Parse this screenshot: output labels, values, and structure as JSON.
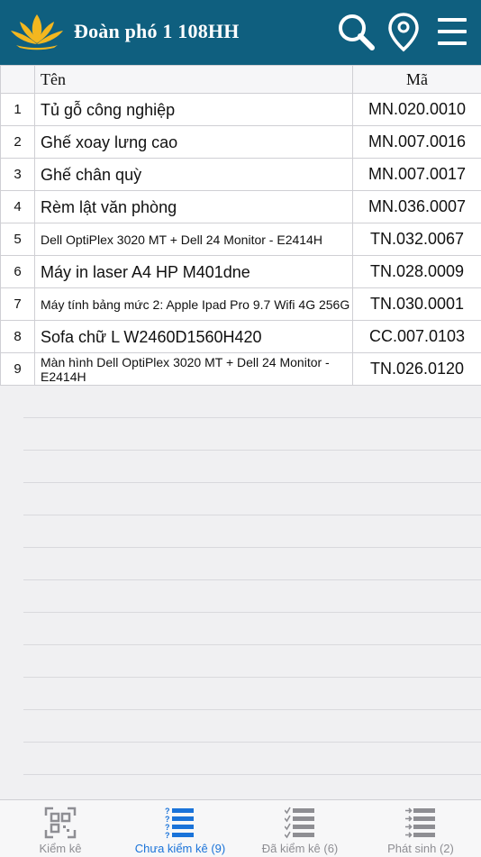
{
  "header": {
    "title": "Đoàn phó 1 108HH",
    "icons": [
      "lotus-logo-icon",
      "search-icon",
      "location-pin-icon",
      "hamburger-menu-icon"
    ],
    "color": "#0f5f7f"
  },
  "table": {
    "col_name": "Tên",
    "col_code": "Mã",
    "rows": [
      {
        "idx": "1",
        "name": "Tủ gỗ công nghiệp",
        "code": "MN.020.0010"
      },
      {
        "idx": "2",
        "name": "Ghế xoay lưng cao",
        "code": "MN.007.0016"
      },
      {
        "idx": "3",
        "name": "Ghế chân quỳ",
        "code": "MN.007.0017"
      },
      {
        "idx": "4",
        "name": "Rèm lật văn phòng",
        "code": "MN.036.0007"
      },
      {
        "idx": "5",
        "name": "Dell OptiPlex 3020 MT + Dell 24 Monitor - E2414H",
        "code": "TN.032.0067"
      },
      {
        "idx": "6",
        "name": "Máy in laser A4 HP M401dne",
        "code": "TN.028.0009"
      },
      {
        "idx": "7",
        "name": "Máy tính bảng mức 2: Apple Ipad Pro 9.7 Wifi 4G 256G",
        "code": "TN.030.0001"
      },
      {
        "idx": "8",
        "name": "Sofa chữ L W2460D1560H420",
        "code": "CC.007.0103"
      },
      {
        "idx": "9",
        "name": "Màn hình Dell OptiPlex 3020 MT + Dell 24 Monitor - E2414H",
        "code": "TN.026.0120"
      }
    ]
  },
  "tabs": [
    {
      "label": "Kiểm kê",
      "icon": "qr-scan-icon",
      "active": false
    },
    {
      "label": "Chưa kiểm kê (9)",
      "icon": "unchecked-list-icon",
      "active": true
    },
    {
      "label": "Đã kiểm kê (6)",
      "icon": "checked-list-icon",
      "active": false
    },
    {
      "label": "Phát sinh (2)",
      "icon": "arrow-list-icon",
      "active": false
    }
  ],
  "colors": {
    "active_tab": "#1a73d9",
    "inactive_tab": "#8e8e93"
  }
}
